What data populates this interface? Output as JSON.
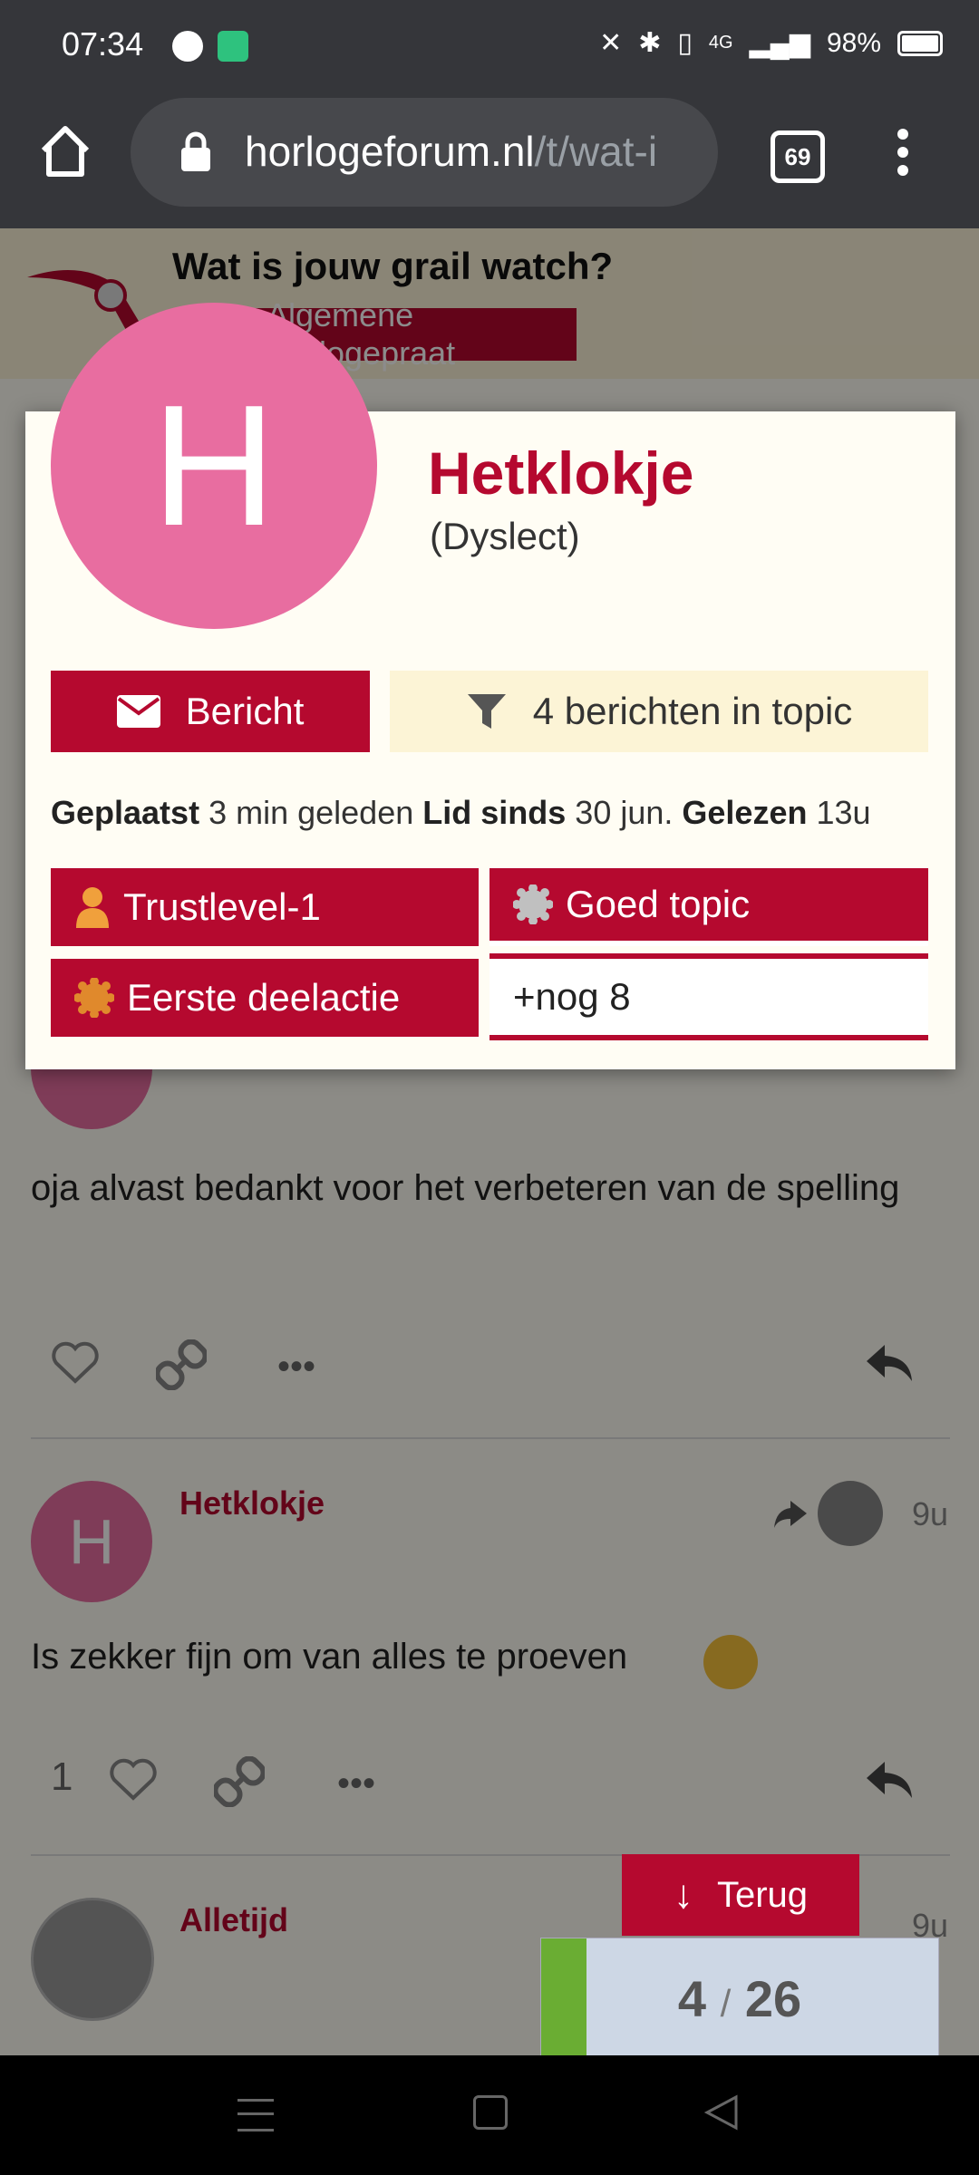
{
  "status": {
    "time": "07:34",
    "network": "4G",
    "battery": "98%"
  },
  "browser": {
    "url_host": "horlogeforum.nl",
    "url_path": "/t/wat-i",
    "tab_count": "69"
  },
  "topic": {
    "title": "Wat is jouw grail watch?",
    "category": "Algemene Horlogepraat"
  },
  "posts": [
    {
      "text": "oja alvast bedankt voor het verbeteren van de spelling"
    },
    {
      "author": "Hetklokje",
      "avatar_letter": "H",
      "time": "9u",
      "text": "Is zekker fijn om van alles te proeven",
      "likes": "1"
    },
    {
      "author": "Alletijd",
      "time": "9u"
    }
  ],
  "back_button": {
    "label": "Terug"
  },
  "timeline": {
    "current": "4",
    "separator": "/",
    "total": "26"
  },
  "user_card": {
    "avatar_letter": "H",
    "username": "Hetklokje",
    "title": "(Dyslect)",
    "message_button": "Bericht",
    "filter_button": "4 berichten in topic",
    "stats": {
      "posted_label": "Geplaatst",
      "posted_value": "3 min geleden",
      "member_label": "Lid sinds",
      "member_value": "30 jun.",
      "read_label": "Gelezen",
      "read_value": "13u"
    },
    "badges": [
      "Trustlevel-1",
      "Goed topic",
      "Eerste deelactie"
    ],
    "more_badges": "+nog 8"
  },
  "colors": {
    "brand": "#b5092f",
    "avatar": "#e86da0",
    "timeline_fill": "#6aad33"
  }
}
